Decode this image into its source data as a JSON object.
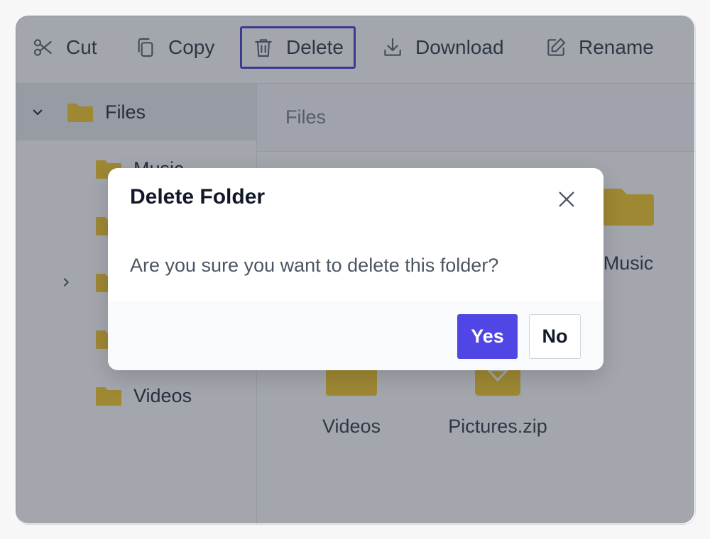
{
  "toolbar": {
    "cut": {
      "label": "Cut",
      "icon": "scissors-icon"
    },
    "copy": {
      "label": "Copy",
      "icon": "copy-icon"
    },
    "delete": {
      "label": "Delete",
      "icon": "trash-icon"
    },
    "download": {
      "label": "Download",
      "icon": "download-icon"
    },
    "rename": {
      "label": "Rename",
      "icon": "edit-icon"
    }
  },
  "sidebar": {
    "root": {
      "label": "Files",
      "expanded": true
    },
    "items": [
      {
        "label": "Music"
      },
      {
        "label": ""
      },
      {
        "label": "",
        "has_children": true
      },
      {
        "label": ""
      },
      {
        "label": "Videos"
      }
    ]
  },
  "main": {
    "breadcrumb": "Files",
    "tiles": [
      {
        "label": "Music",
        "type": "folder"
      },
      {
        "label": "Videos",
        "type": "folder"
      },
      {
        "label": "Pictures.zip",
        "type": "zip"
      }
    ]
  },
  "dialog": {
    "title": "Delete Folder",
    "message": "Are you sure you want to delete this folder?",
    "yes_label": "Yes",
    "no_label": "No"
  },
  "colors": {
    "accent": "#4f46e5",
    "folder": "#f5c518",
    "overlay": "rgba(62,68,84,0.48)",
    "active_outline": "#3b30c9"
  }
}
